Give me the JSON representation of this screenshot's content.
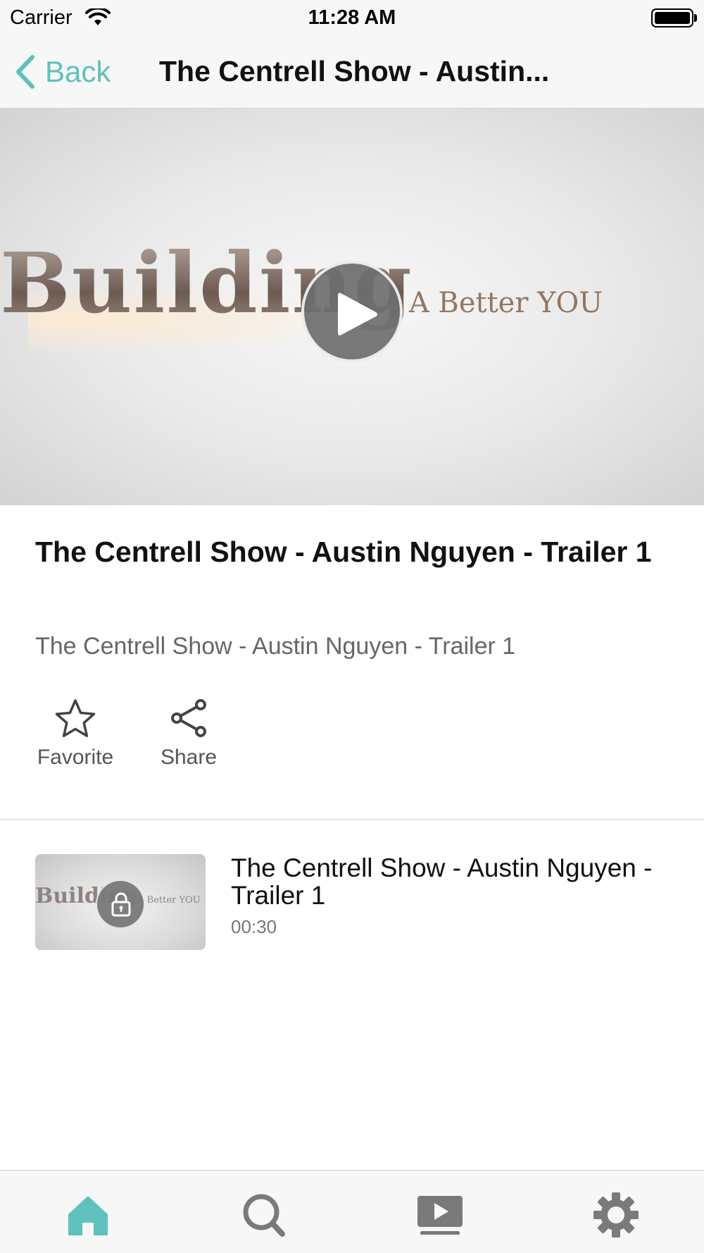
{
  "status_bar": {
    "carrier": "Carrier",
    "time": "11:28 AM",
    "battery_level": 1.0
  },
  "nav": {
    "back_label": "Back",
    "title": "The Centrell Show - Austin..."
  },
  "video": {
    "thumbnail_text_large": "Building",
    "thumbnail_text_small": "A Better YOU",
    "play_icon": "play-icon"
  },
  "details": {
    "title": "The Centrell Show - Austin Nguyen - Trailer 1",
    "description": "The Centrell Show - Austin Nguyen - Trailer 1"
  },
  "actions": {
    "favorite_label": "Favorite",
    "favorite_icon": "star-icon",
    "share_label": "Share",
    "share_icon": "share-icon"
  },
  "episodes": [
    {
      "title": "The Centrell Show - Austin Nguyen - Trailer 1",
      "duration": "00:30",
      "thumbnail_text_large": "Building",
      "thumbnail_text_small": "A Better YOU",
      "locked": true
    }
  ],
  "tab_bar": {
    "tabs": [
      {
        "icon": "home-icon",
        "active": true
      },
      {
        "icon": "search-icon",
        "active": false
      },
      {
        "icon": "video-library-icon",
        "active": false
      },
      {
        "icon": "gear-icon",
        "active": false
      }
    ]
  },
  "colors": {
    "accent": "#5ec1bd",
    "inactive_icon": "#7a7a7a",
    "background_bar": "#f7f7f7"
  }
}
